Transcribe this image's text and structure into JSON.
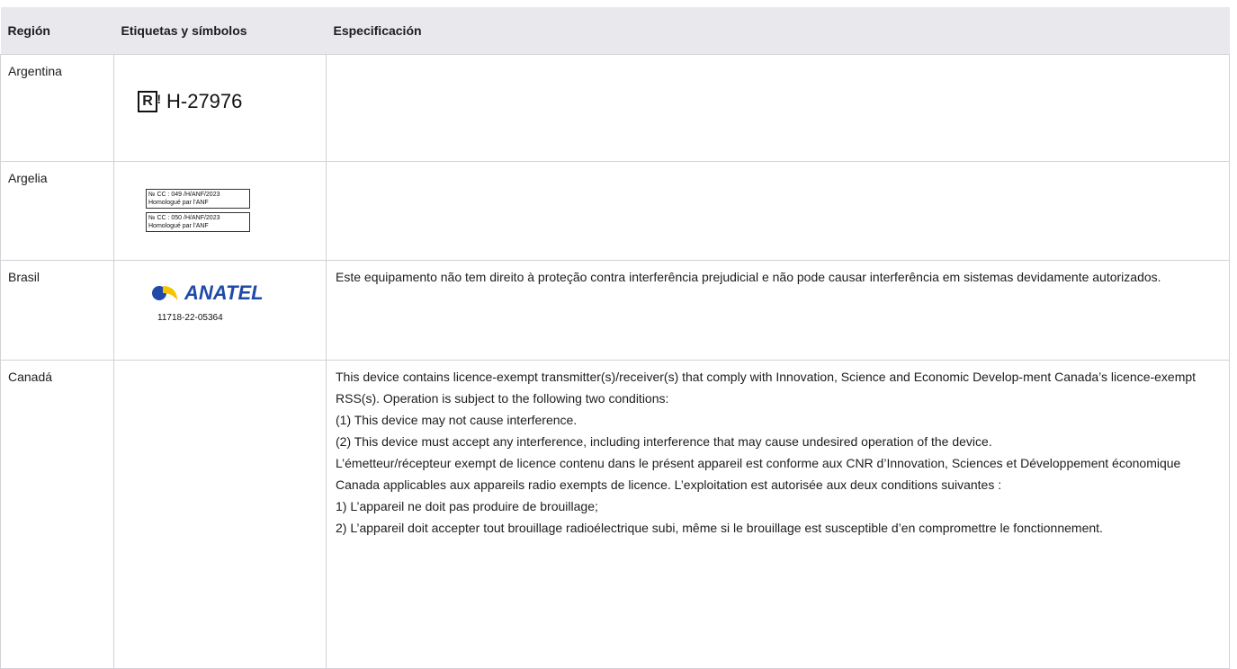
{
  "headers": {
    "region": "Región",
    "labels": "Etiquetas y símbolos",
    "spec": "Especificación"
  },
  "rows": [
    {
      "region": "Argentina",
      "symbol": {
        "icon": "argentina-r-mark-icon",
        "code": "H-27976"
      },
      "spec": []
    },
    {
      "region": "Argelia",
      "symbol": {
        "labels": [
          {
            "line1": "№ CC : 049 /H/ANF/2023",
            "line2": "Homologué par l'ANF"
          },
          {
            "line1": "№ CC : 050 /H/ANF/2023",
            "line2": "Homologué par l'ANF"
          }
        ]
      },
      "spec": []
    },
    {
      "region": "Brasil",
      "symbol": {
        "icon": "anatel-logo-icon",
        "brand": "ANATEL",
        "code": "11718-22-05364",
        "brand_color": "#1f4aa8",
        "accent_color": "#f5c400"
      },
      "spec": [
        "Este equipamento não tem direito à proteção contra interferência prejudicial e não pode causar interferência em sistemas devidamente autorizados."
      ]
    },
    {
      "region": "Canadá",
      "symbol": {},
      "spec": [
        "This device contains licence-exempt transmitter(s)/receiver(s) that comply with Innovation, Science and Economic Develop-ment Canada’s licence-exempt RSS(s). Operation is subject to the following two conditions:",
        "(1) This device may not cause interference.",
        "(2) This device must accept any interference, including interference that may cause undesired operation of the device.",
        "L’émetteur/récepteur exempt de licence contenu dans le présent appareil est conforme aux CNR d’Innovation, Sciences et Développement économique Canada applicables aux appareils radio exempts de licence. L’exploitation est autorisée aux deux conditions suivantes :",
        "1) L’appareil ne doit pas produire de brouillage;",
        "2) L’appareil doit accepter tout brouillage radioélectrique subi, même si le brouillage est susceptible d’en compromettre le fonctionnement."
      ]
    }
  ]
}
